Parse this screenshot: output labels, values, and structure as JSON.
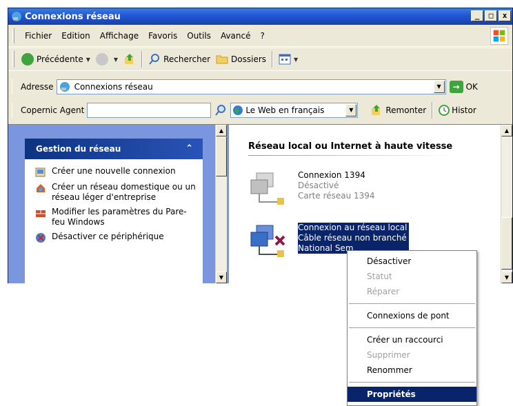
{
  "window": {
    "title": "Connexions réseau"
  },
  "menubar": {
    "items": [
      "Fichier",
      "Edition",
      "Affichage",
      "Favoris",
      "Outils",
      "Avancé",
      "?"
    ]
  },
  "toolbar": {
    "back_label": "Précédente",
    "search_label": "Rechercher",
    "folders_label": "Dossiers"
  },
  "address": {
    "label": "Adresse",
    "value": "Connexions réseau",
    "go_label": "OK"
  },
  "copernic": {
    "label": "Copernic Agent",
    "input_value": "",
    "select_value": "Le Web en français",
    "up_label": "Remonter",
    "history_label": "Histor"
  },
  "tasks": {
    "header": "Gestion du réseau",
    "items": [
      "Créer une nouvelle connexion",
      "Créer un réseau domestique ou un réseau léger d'entreprise",
      "Modifier les paramètres du Pare-feu Windows",
      "Désactiver ce périphérique"
    ]
  },
  "group": {
    "title": "Réseau local ou Internet à haute vitesse"
  },
  "connections": [
    {
      "name": "Connexion 1394",
      "status": "Désactivé",
      "device": "Carte réseau 1394"
    },
    {
      "name": "Connexion au réseau local",
      "status": "Câble réseau non branché",
      "device": "National Sem"
    }
  ],
  "context_menu": {
    "items": [
      {
        "label": "Désactiver",
        "state": "enabled"
      },
      {
        "label": "Statut",
        "state": "disabled"
      },
      {
        "label": "Réparer",
        "state": "disabled"
      },
      {
        "label": "Connexions de pont",
        "state": "enabled"
      },
      {
        "label": "Créer un raccourci",
        "state": "enabled"
      },
      {
        "label": "Supprimer",
        "state": "disabled"
      },
      {
        "label": "Renommer",
        "state": "enabled"
      },
      {
        "label": "Propriétés",
        "state": "default"
      }
    ]
  },
  "colors": {
    "title_blue": "#2157d6",
    "task_header": "#0c3480",
    "selection": "#0a246a"
  }
}
